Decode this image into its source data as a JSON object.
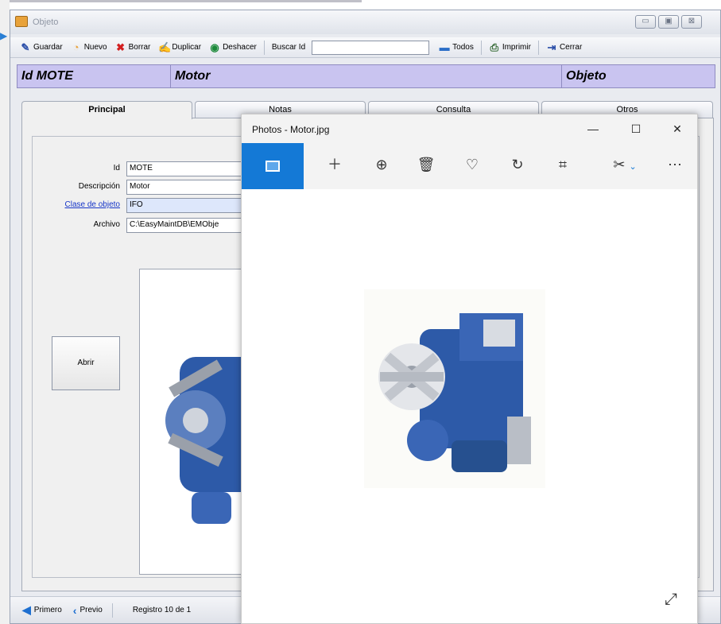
{
  "app": {
    "title": "Objeto",
    "window_controls": {
      "minimize": "▭",
      "maximize": "▣",
      "close": "⊠"
    }
  },
  "toolbar": {
    "guardar": "Guardar",
    "nuevo": "Nuevo",
    "borrar": "Borrar",
    "duplicar": "Duplicar",
    "deshacer": "Deshacer",
    "buscar_id": "Buscar Id",
    "search_value": "",
    "todos": "Todos",
    "imprimir": "Imprimir",
    "cerrar": "Cerrar"
  },
  "record_header": {
    "id": "Id MOTE",
    "description": "Motor",
    "type": "Objeto",
    "background": "#c9c4f0"
  },
  "tabs": [
    {
      "label": "Principal",
      "active": true
    },
    {
      "label": "Notas",
      "active": false
    },
    {
      "label": "Consulta",
      "active": false
    },
    {
      "label": "Otros",
      "active": false
    }
  ],
  "form": {
    "id_label": "Id",
    "id_value": "MOTE",
    "descripcion_label": "Descripción",
    "descripcion_value": "Motor",
    "clase_label": "Clase de objeto",
    "clase_value": "IFO",
    "archivo_label": "Archivo",
    "archivo_value": "C:\\EasyMaintDB\\EMObje",
    "abrir_label": "Abrir"
  },
  "statusbar": {
    "primero": "Primero",
    "previo": "Previo",
    "registro": "Registro 10 de 1"
  },
  "photos": {
    "title": "Photos - Motor.jpg",
    "controls": {
      "minimize": "—",
      "maximize": "☐",
      "close": "✕"
    },
    "accent": "#1479d6",
    "toolbar_icons": [
      "gallery-icon",
      "add-icon",
      "zoom-icon",
      "delete-icon",
      "favorite-icon",
      "rotate-icon",
      "crop-icon",
      "edit-icon",
      "more-icon"
    ]
  }
}
